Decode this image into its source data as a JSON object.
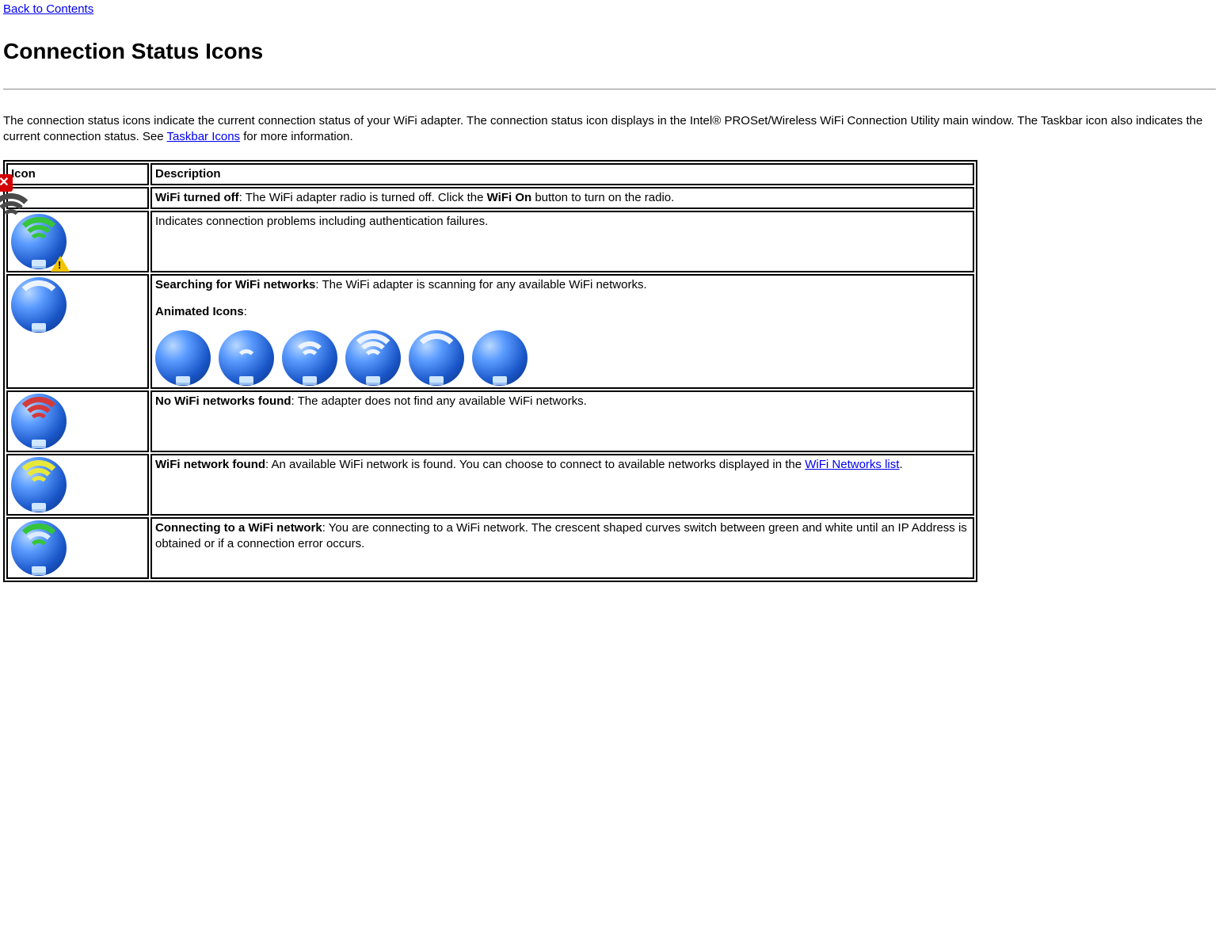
{
  "nav": {
    "back_link": "Back to Contents"
  },
  "title": "Connection Status Icons",
  "intro": {
    "text_before_link": "The connection status icons indicate the current connection status of your WiFi adapter. The connection status icon displays in the Intel® PROSet/Wireless WiFi Connection Utility main window. The Taskbar icon also indicates the current connection status. See ",
    "link_text": "Taskbar Icons",
    "text_after_link": " for more information."
  },
  "table": {
    "headers": {
      "icon": "Icon",
      "description": "Description"
    },
    "rows": [
      {
        "icon_name": "wifi-off-icon",
        "label": "WiFi turned off",
        "sep": ": ",
        "desc_before": "The WiFi adapter radio is turned off. Click the ",
        "inline_bold": "WiFi On",
        "desc_after": " button to turn on the radio."
      },
      {
        "icon_name": "wifi-problem-icon",
        "plain": "Indicates connection problems including authentication failures."
      },
      {
        "icon_name": "wifi-searching-icon",
        "label": "Searching for WiFi networks",
        "sep": ": ",
        "desc": "The WiFi adapter is scanning for any available WiFi networks.",
        "sub_label": "Animated Icons",
        "sub_sep": ":"
      },
      {
        "icon_name": "wifi-none-found-icon",
        "label": "No WiFi networks found",
        "sep": ": ",
        "desc": "The adapter does not find any available WiFi networks."
      },
      {
        "icon_name": "wifi-found-icon",
        "label": "WiFi network found",
        "sep": ": ",
        "desc_before": "An available WiFi network is found. You can choose to connect to available networks displayed in the ",
        "link_text": "WiFi Networks list",
        "desc_after": "."
      },
      {
        "icon_name": "wifi-connecting-icon",
        "label": "Connecting to a WiFi network",
        "sep": ": ",
        "desc": "You are connecting to a WiFi network. The crescent shaped curves switch between green and white until an IP Address is obtained or if a connection error occurs."
      }
    ]
  }
}
